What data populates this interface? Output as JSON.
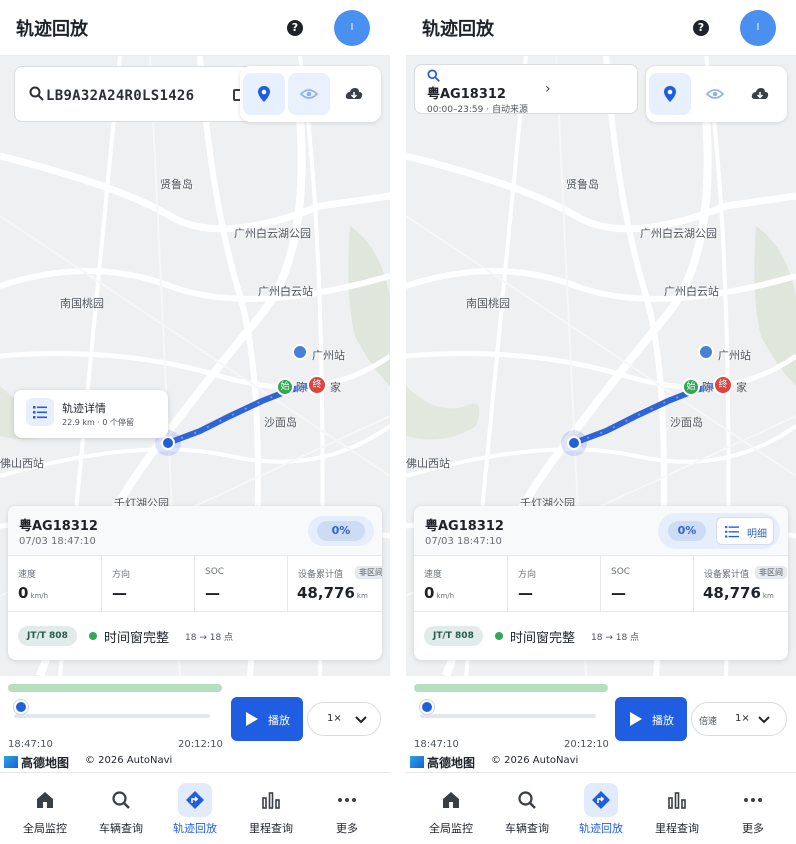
{
  "header": {
    "title": "轨迹回放",
    "help_glyph": "?",
    "avatar_letter": "I"
  },
  "left": {
    "search_vin": "LB9A32A24R0LS1426",
    "detail_card": {
      "title": "轨迹详情",
      "subtitle": "22.9 km · 0 个停留"
    }
  },
  "right": {
    "plate_box": {
      "plate": "粤AG18312",
      "range": "00:00–23:59 · 自动来源",
      "arrow": "›"
    }
  },
  "map": {
    "labels": [
      "贤鲁岛",
      "广州白云湖公园",
      "广州白云站",
      "南国桃园",
      "广州站",
      "沙面岛",
      "陈",
      "家",
      "佛山西站",
      "千灯湖公园"
    ],
    "start_glyph": "始",
    "end_glyph": "终"
  },
  "info": {
    "plate": "粤AG18312",
    "time": "07/03 18:47:10",
    "progress": "0%",
    "detail_button": "明细",
    "stats": [
      {
        "label": "速度",
        "value": "0",
        "unit": "km/h"
      },
      {
        "label": "方向",
        "value": "—",
        "unit": ""
      },
      {
        "label": "SOC",
        "value": "—",
        "unit": ""
      },
      {
        "label": "设备累计值",
        "value": "48,776",
        "unit": "km",
        "tag": "非区间"
      }
    ],
    "protocol": "JT/T 808",
    "window_status": "时间窗完整",
    "hour_range": "18 → 18 点"
  },
  "playback": {
    "progress": 0,
    "play_label": "播放",
    "speed_label": "倍速",
    "speed_value": "1×",
    "time_start": "18:47:10",
    "time_end": "20:12:10"
  },
  "attribution": {
    "logo": "高德地图",
    "copyright": "© 2026 AutoNavi"
  },
  "tabs": [
    {
      "label": "全局监控",
      "icon": "home-icon",
      "active": false
    },
    {
      "label": "车辆查询",
      "icon": "search-icon",
      "active": false
    },
    {
      "label": "轨迹回放",
      "icon": "route-icon",
      "active": true
    },
    {
      "label": "里程查询",
      "icon": "bar-chart-icon",
      "active": false
    },
    {
      "label": "更多",
      "icon": "more-icon",
      "active": false
    }
  ],
  "colors": {
    "primary": "#1f5ee0",
    "route": "#3a6fe0",
    "start": "#2fa84f",
    "end": "#e0433c",
    "buffer": "#b6dfbf"
  }
}
